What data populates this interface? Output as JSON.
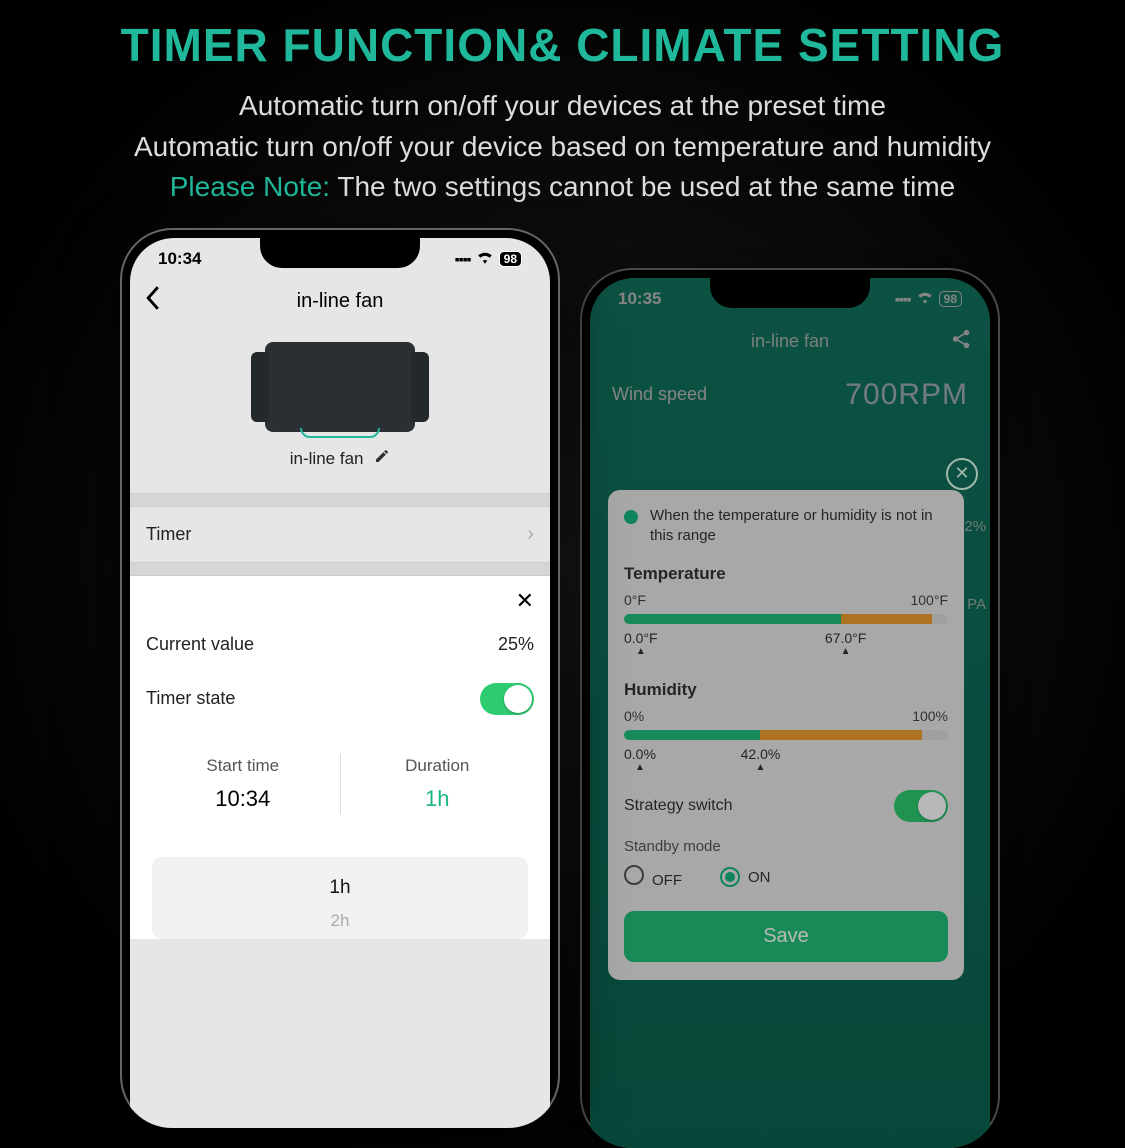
{
  "header": {
    "title": "TIMER FUNCTION& CLIMATE SETTING",
    "line1": "Automatic turn on/off your devices at the preset time",
    "line2": "Automatic turn on/off your device based on temperature and humidity",
    "note_label": "Please Note:",
    "note_text": " The two settings cannot be used at the same time"
  },
  "phone_a": {
    "status": {
      "time": "10:34",
      "battery": "98"
    },
    "title": "in-line fan",
    "device_label": "in-line fan",
    "timer_section": "Timer",
    "panel": {
      "current_value_label": "Current value",
      "current_value": "25%",
      "timer_state_label": "Timer state",
      "timer_state": true,
      "start_label": "Start time",
      "start_value": "10:34",
      "duration_label": "Duration",
      "duration_value": "1h",
      "options": [
        "1h",
        "2h"
      ]
    }
  },
  "phone_b": {
    "status": {
      "time": "10:35",
      "battery": "98"
    },
    "title": "in-line fan",
    "wind_label": "Wind speed",
    "wind_value": "700RPM",
    "side_pct": "2%",
    "side_pa": "PA",
    "card": {
      "tip": "When the temperature or humidity is not in this range",
      "temp_title": "Temperature",
      "temp_min": "0°F",
      "temp_max": "100°F",
      "temp_low": "0.0°F",
      "temp_high": "67.0°F",
      "temp_green_pct": 67,
      "temp_orange_pct": 28,
      "hum_title": "Humidity",
      "hum_min": "0%",
      "hum_max": "100%",
      "hum_low": "0.0%",
      "hum_high": "42.0%",
      "hum_green_pct": 42,
      "hum_orange_pct": 50,
      "strategy_label": "Strategy switch",
      "strategy_on": true,
      "standby_label": "Standby mode",
      "standby_off": "OFF",
      "standby_on": "ON",
      "standby_value": "ON",
      "save": "Save"
    }
  }
}
